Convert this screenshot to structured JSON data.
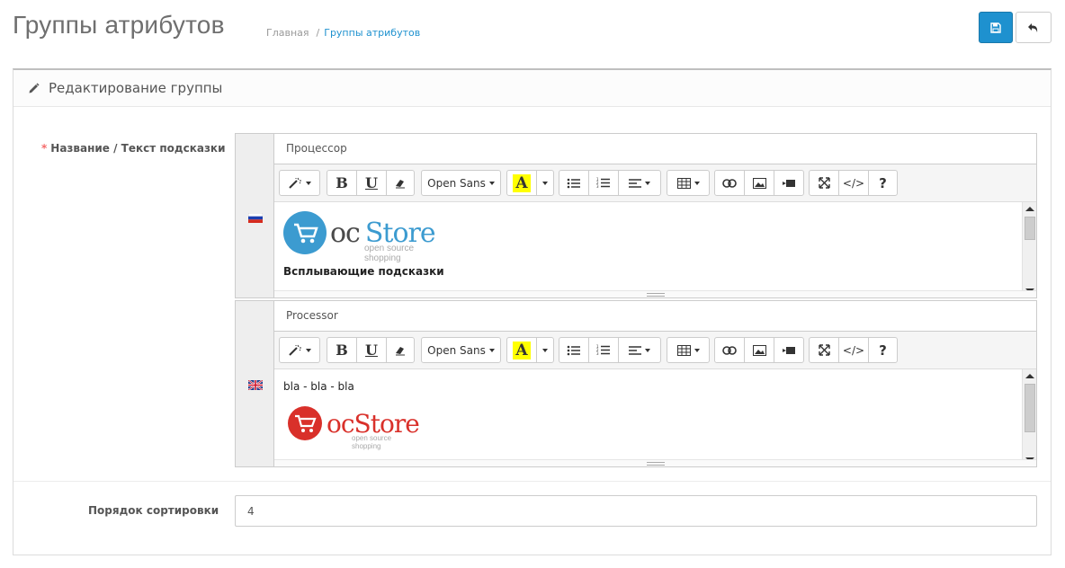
{
  "header": {
    "title": "Группы атрибутов",
    "breadcrumb": [
      {
        "label": "Главная"
      },
      {
        "label": "Группы атрибутов"
      }
    ],
    "save_icon": "save-icon",
    "back_icon": "reply-icon",
    "save_color": "#1e91cf"
  },
  "panel": {
    "title": "Редактирование группы",
    "title_icon": "pencil-icon"
  },
  "form": {
    "name_label_required": "*",
    "name_label": "Название / Текст подсказки",
    "sort_label": "Порядок сортировки",
    "sort_value": "4"
  },
  "toolbar": {
    "font_name": "Open Sans",
    "bold": "B",
    "underline": "U",
    "highlight": "A",
    "help": "?",
    "code": "</>"
  },
  "languages": [
    {
      "flag": "russia-flag-icon",
      "name": "Процессор",
      "editor_heading": "Всплывающие подсказки",
      "logo_text_oc": "oc",
      "logo_text_store": "Store",
      "logo_sub": "open source shopping",
      "logo_color": "#3c9bd0"
    },
    {
      "flag": "uk-flag-icon",
      "name": "Processor",
      "editor_text": "bla - bla - bla",
      "logo_text": "ocStore",
      "logo_sub": "open source shopping",
      "logo_color": "#d9302a"
    }
  ]
}
